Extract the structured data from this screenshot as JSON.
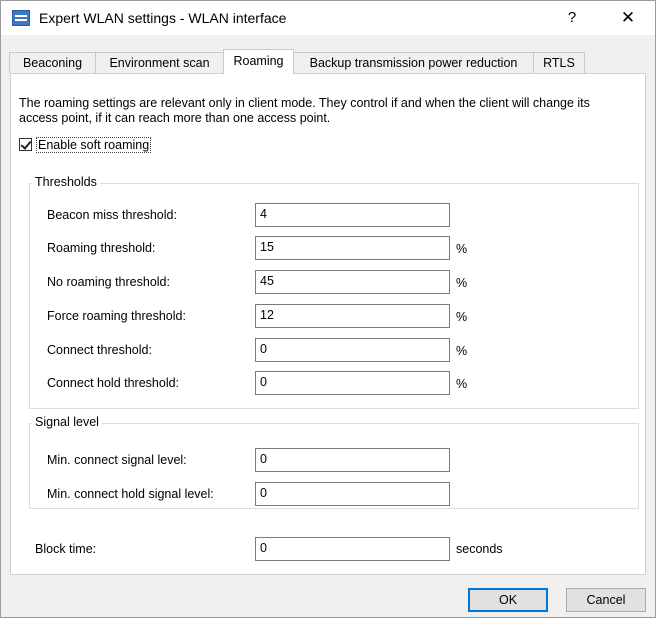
{
  "window": {
    "title": "Expert WLAN settings - WLAN interface",
    "help": "?",
    "close": "✕"
  },
  "tabs": [
    "Beaconing",
    "Environment scan",
    "Roaming",
    "Backup transmission power reduction",
    "RTLS"
  ],
  "active_tab": "Roaming",
  "description": "The roaming settings are relevant only in client mode. They control if and when the client will change its access point, if it can reach more than one access point.",
  "soft_roaming": {
    "label": "Enable soft roaming",
    "checked": true
  },
  "thresholds": {
    "title": "Thresholds",
    "fields": [
      {
        "label": "Beacon miss threshold:",
        "value": "4",
        "unit": ""
      },
      {
        "label": "Roaming threshold:",
        "value": "15",
        "unit": "%"
      },
      {
        "label": "No roaming threshold:",
        "value": "45",
        "unit": "%"
      },
      {
        "label": "Force roaming threshold:",
        "value": "12",
        "unit": "%"
      },
      {
        "label": "Connect threshold:",
        "value": "0",
        "unit": "%"
      },
      {
        "label": "Connect hold threshold:",
        "value": "0",
        "unit": "%"
      }
    ]
  },
  "signal_level": {
    "title": "Signal level",
    "fields": [
      {
        "label": "Min. connect signal level:",
        "value": "0"
      },
      {
        "label": "Min. connect hold signal level:",
        "value": "0"
      }
    ]
  },
  "block_time": {
    "label": "Block time:",
    "value": "0",
    "unit": "seconds"
  },
  "buttons": {
    "ok": "OK",
    "cancel": "Cancel"
  }
}
